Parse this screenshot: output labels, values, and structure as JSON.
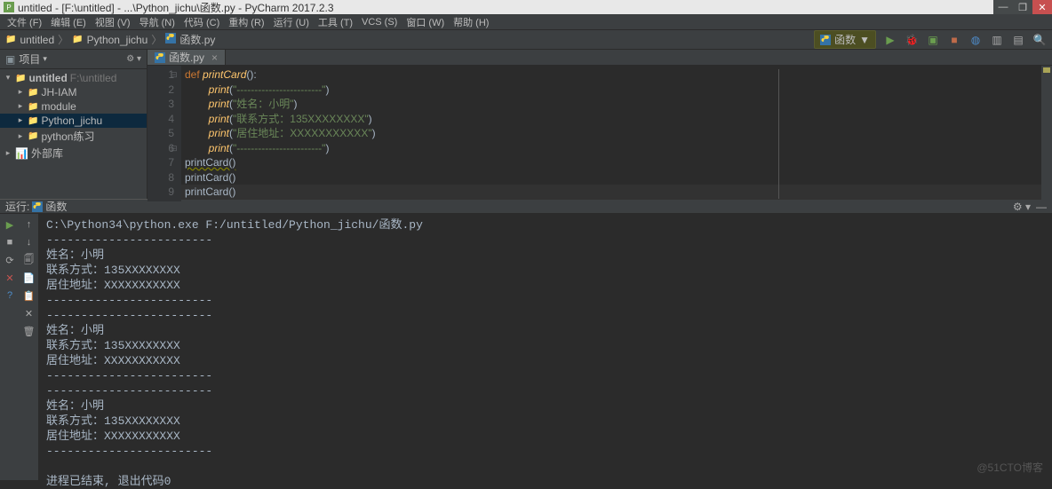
{
  "title": "untitled - [F:\\untitled] - ...\\Python_jichu\\函数.py - PyCharm 2017.2.3",
  "window": {
    "min": "—",
    "max": "❐",
    "close": "✕"
  },
  "menu": [
    "文件 (F)",
    "编辑 (E)",
    "视图 (V)",
    "导航 (N)",
    "代码 (C)",
    "重构 (R)",
    "运行 (U)",
    "工具 (T)",
    "VCS (S)",
    "窗口 (W)",
    "帮助 (H)"
  ],
  "breadcrumb": {
    "items": [
      "untitled",
      "Python_jichu",
      "函数.py"
    ]
  },
  "toolbar": {
    "runconf": "函数",
    "runconf_arrow": "▼",
    "icons": [
      "▶",
      "🐞",
      "▶⎋",
      "●",
      "◯",
      "▤",
      "▤",
      "🔍"
    ]
  },
  "sidebar": {
    "header": "项目",
    "header_arrow": "▾",
    "gear": "⚙ ▾",
    "root": "untitled",
    "root_dim": "F:\\untitled",
    "items": [
      {
        "indent": 1,
        "arrow": "▸",
        "icon": "📁",
        "label": "JH-IAM"
      },
      {
        "indent": 1,
        "arrow": "▸",
        "icon": "📁",
        "label": "module"
      },
      {
        "indent": 1,
        "arrow": "▸",
        "icon": "📁",
        "label": "Python_jichu",
        "sel": true
      },
      {
        "indent": 1,
        "arrow": "▸",
        "icon": "📁",
        "label": "python练习"
      }
    ],
    "ext": {
      "arrow": "▸",
      "icon": "📊",
      "label": "外部库"
    }
  },
  "tab": {
    "name": "函数.py",
    "close": "×"
  },
  "code": {
    "lines": [
      {
        "n": "1",
        "segs": [
          [
            "kw",
            "def "
          ],
          [
            "fn",
            "printCard"
          ],
          [
            "par",
            "():"
          ]
        ],
        "indent": 0
      },
      {
        "n": "2",
        "segs": [
          [
            "fn",
            "print"
          ],
          [
            "par",
            "("
          ],
          [
            "str",
            "\"------------------------\""
          ],
          [
            "par",
            ")"
          ]
        ],
        "indent": 2
      },
      {
        "n": "3",
        "segs": [
          [
            "fn",
            "print"
          ],
          [
            "par",
            "("
          ],
          [
            "str",
            "\"姓名：小明\""
          ],
          [
            "par",
            ")"
          ]
        ],
        "indent": 2
      },
      {
        "n": "4",
        "segs": [
          [
            "fn",
            "print"
          ],
          [
            "par",
            "("
          ],
          [
            "str",
            "\"联系方式：135XXXXXXXX\""
          ],
          [
            "par",
            ")"
          ]
        ],
        "indent": 2
      },
      {
        "n": "5",
        "segs": [
          [
            "fn",
            "print"
          ],
          [
            "par",
            "("
          ],
          [
            "str",
            "\"居住地址：XXXXXXXXXXX\""
          ],
          [
            "par",
            ")"
          ]
        ],
        "indent": 2
      },
      {
        "n": "6",
        "segs": [
          [
            "fn",
            "print"
          ],
          [
            "par",
            "("
          ],
          [
            "str",
            "\"------------------------\""
          ],
          [
            "par",
            ")"
          ]
        ],
        "indent": 2
      },
      {
        "n": "7",
        "segs": [
          [
            "par",
            "printCard()"
          ]
        ],
        "indent": 0,
        "warn": true
      },
      {
        "n": "8",
        "segs": [
          [
            "par",
            "printCard()"
          ]
        ],
        "indent": 0
      },
      {
        "n": "9",
        "segs": [
          [
            "par",
            "printCard()"
          ]
        ],
        "indent": 0,
        "caret": true
      }
    ]
  },
  "run": {
    "header_label": "运行:",
    "header_name": "函数",
    "gear": "⚙ ▾",
    "min": "—",
    "ctrl1": [
      [
        "play",
        "▶"
      ],
      [
        "gray",
        "■"
      ],
      [
        "gray",
        "⟳"
      ],
      [
        "red",
        "✕"
      ],
      [
        "qmark",
        "?"
      ]
    ],
    "ctrl2": [
      "↑",
      "↓",
      "🗐",
      "📄",
      "📋",
      "✕",
      "🗑"
    ],
    "lines": [
      "C:\\Python34\\python.exe F:/untitled/Python_jichu/函数.py",
      "------------------------",
      "姓名：小明",
      "联系方式：135XXXXXXXX",
      "居住地址：XXXXXXXXXXX",
      "------------------------",
      "------------------------",
      "姓名：小明",
      "联系方式：135XXXXXXXX",
      "居住地址：XXXXXXXXXXX",
      "------------------------",
      "------------------------",
      "姓名：小明",
      "联系方式：135XXXXXXXX",
      "居住地址：XXXXXXXXXXX",
      "------------------------",
      "",
      "进程已结束, 退出代码0"
    ]
  },
  "watermark": "@51CTO博客"
}
